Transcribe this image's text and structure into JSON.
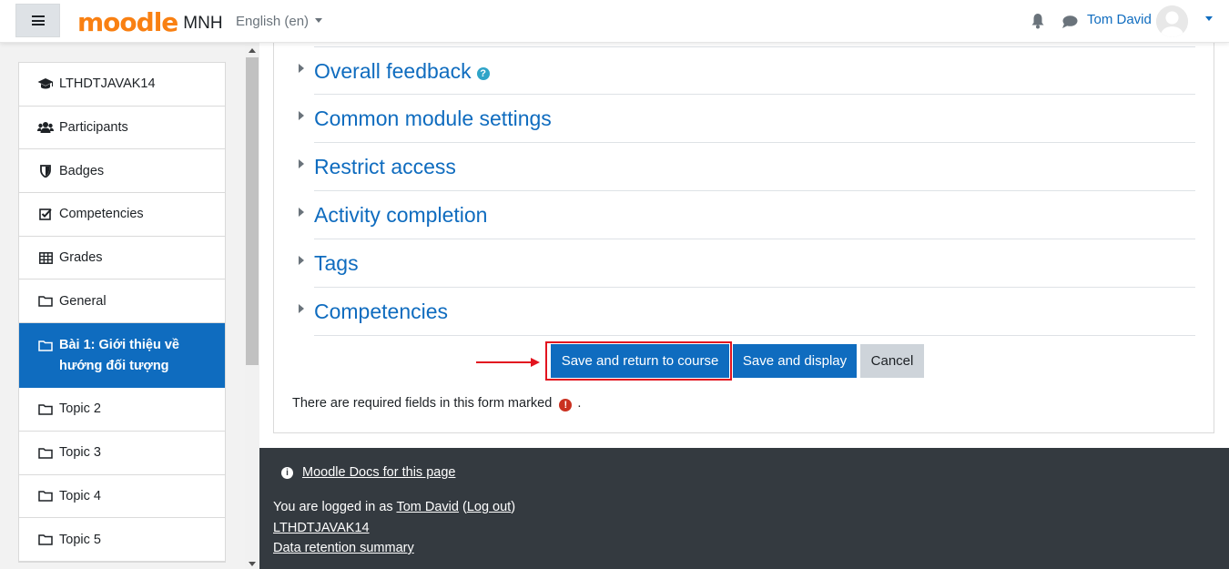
{
  "header": {
    "logo_text": "moodle",
    "site_name": "MNH",
    "language": "English (en)",
    "user_name": "Tom David"
  },
  "sidebar": {
    "items": [
      {
        "label": "LTHDTJAVAK14",
        "icon": "graduation-cap-icon"
      },
      {
        "label": "Participants",
        "icon": "users-icon"
      },
      {
        "label": "Badges",
        "icon": "shield-icon"
      },
      {
        "label": "Competencies",
        "icon": "check-square-icon"
      },
      {
        "label": "Grades",
        "icon": "table-icon"
      },
      {
        "label": "General",
        "icon": "folder-icon"
      },
      {
        "label": "Bài 1: Giới thiệu về hướng đối tượng",
        "icon": "folder-icon",
        "active": true
      },
      {
        "label": "Topic 2",
        "icon": "folder-icon"
      },
      {
        "label": "Topic 3",
        "icon": "folder-icon"
      },
      {
        "label": "Topic 4",
        "icon": "folder-icon"
      },
      {
        "label": "Topic 5",
        "icon": "folder-icon"
      }
    ]
  },
  "form": {
    "sections": [
      "Overall feedback",
      "Common module settings",
      "Restrict access",
      "Activity completion",
      "Tags",
      "Competencies"
    ],
    "buttons": {
      "save_return": "Save and return to course",
      "save_display": "Save and display",
      "cancel": "Cancel"
    },
    "required_note": "There are required fields in this form marked",
    "required_suffix": "."
  },
  "footer": {
    "docs_link": "Moodle Docs for this page",
    "logged_in_prefix": "You are logged in as",
    "logged_in_user": "Tom David",
    "logout": "Log out",
    "course_link": "LTHDTJAVAK14",
    "retention_link": "Data retention summary"
  },
  "colors": {
    "brand": "#0f6cbf",
    "logo": "#f98012",
    "annotation": "#e2141f",
    "footer_bg": "#343a40"
  }
}
